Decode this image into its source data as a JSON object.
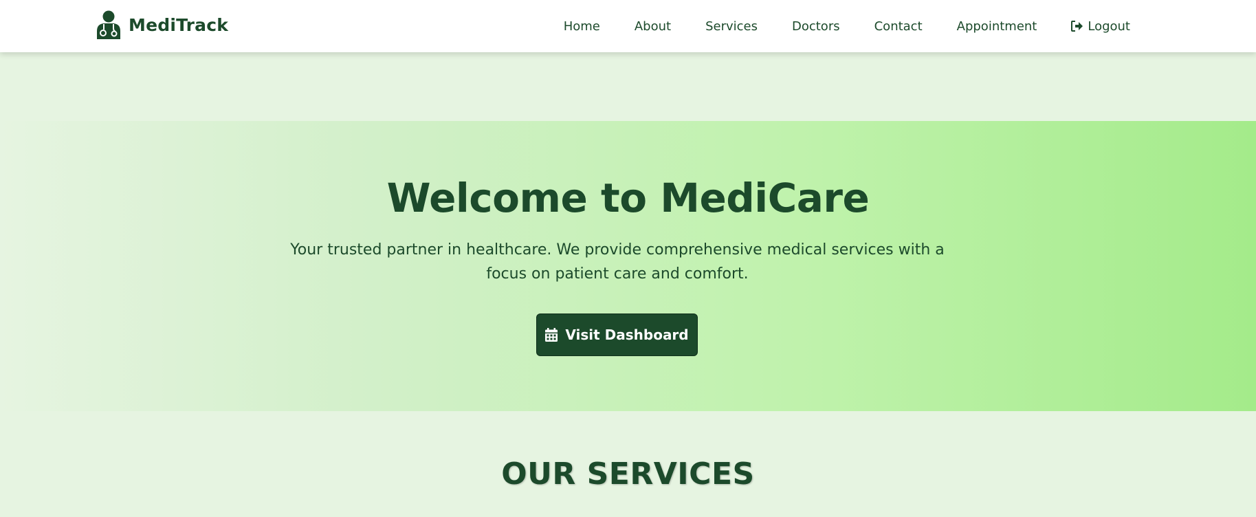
{
  "brand": {
    "name": "MediTrack",
    "icon": "doctor-icon"
  },
  "nav": {
    "items": [
      {
        "label": "Home"
      },
      {
        "label": "About"
      },
      {
        "label": "Services"
      },
      {
        "label": "Doctors"
      },
      {
        "label": "Contact"
      },
      {
        "label": "Appointment"
      }
    ],
    "logout": {
      "label": "Logout",
      "icon": "logout-icon"
    }
  },
  "hero": {
    "title": "Welcome to MediCare",
    "text": "Your trusted partner in healthcare. We provide comprehensive medical services with a focus on patient care and comfort.",
    "button_label": "Visit Dashboard",
    "button_icon": "calendar-icon"
  },
  "services": {
    "heading": "OUR SERVICES"
  },
  "colors": {
    "primary": "#1c4a2b",
    "page_background": "#e6f4e1",
    "hero_gradient_start": "#e6f4e1",
    "hero_gradient_end": "#a4eb8a",
    "navbar_background": "#ffffff"
  }
}
